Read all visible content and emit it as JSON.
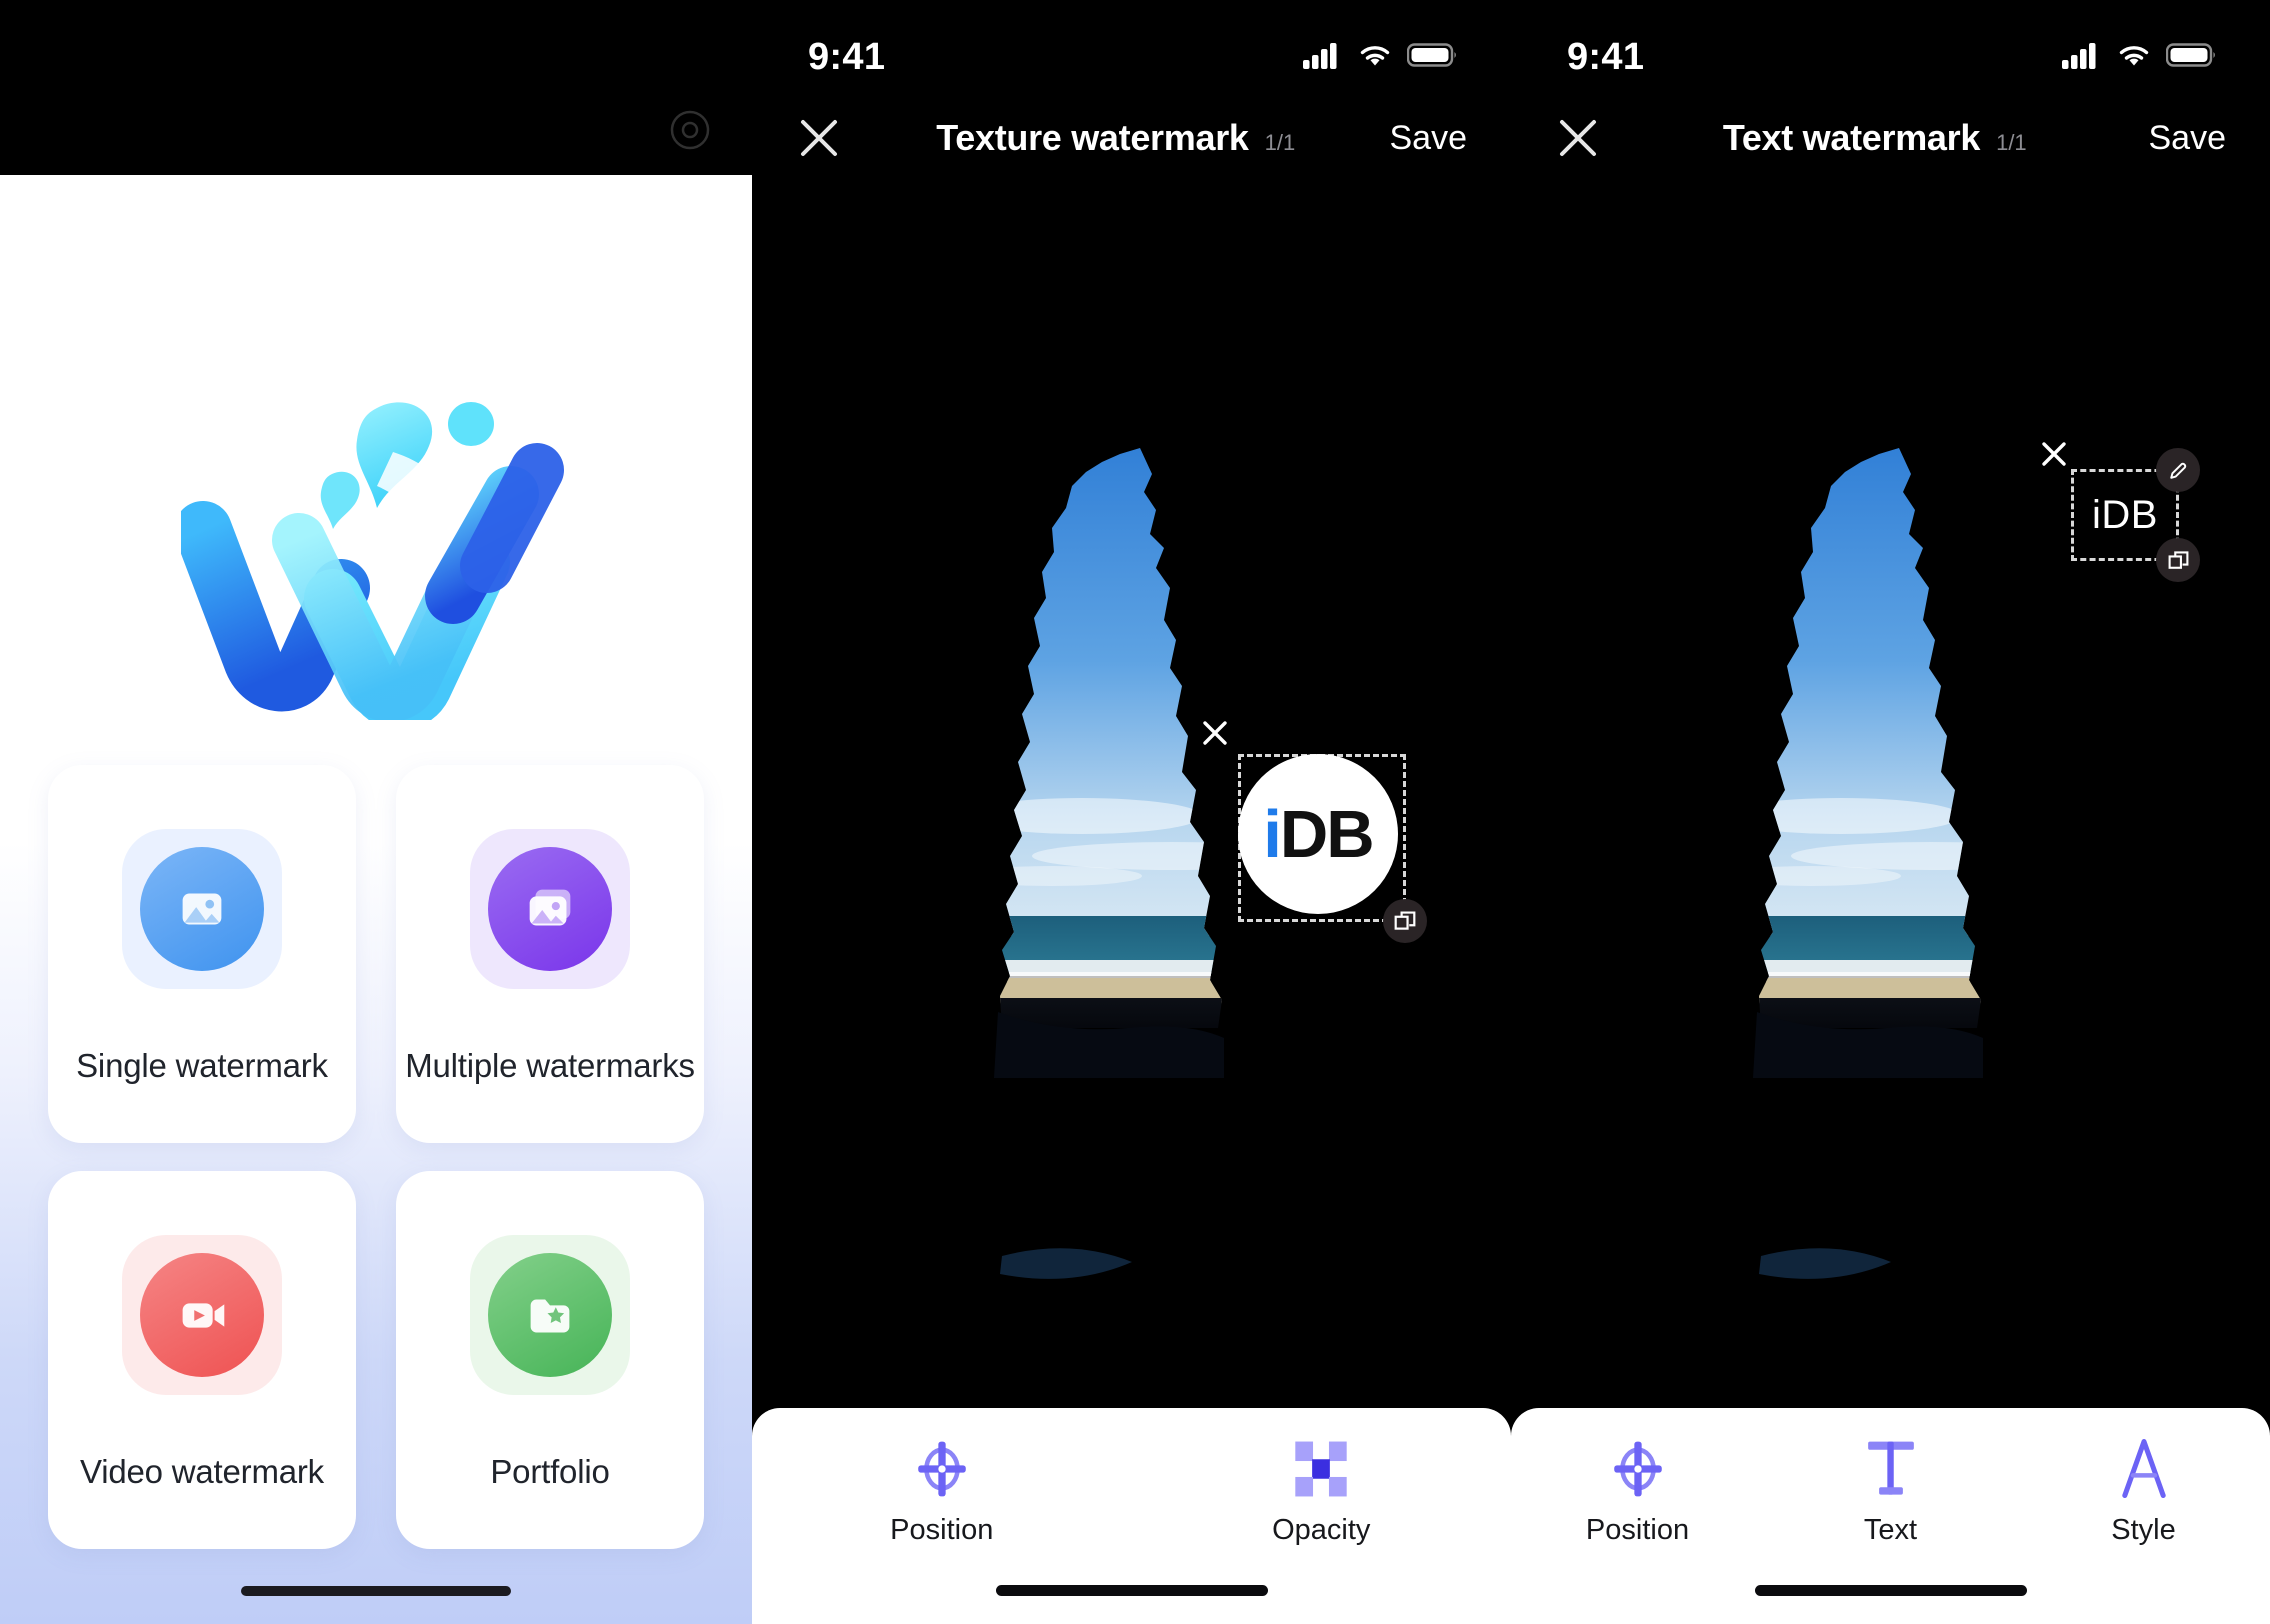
{
  "app": {
    "name": "Watermark app",
    "accent": "#6c63f5",
    "brand_blue": "#1f7bea"
  },
  "panel1": {
    "gear_icon": "gear-icon",
    "logo_alt": "watermark-logo",
    "cards": [
      {
        "label": "Single watermark",
        "icon": "image-icon",
        "tint_bg": "#eaf1ff",
        "tint_circle_from": "#7cb6f7",
        "tint_circle_to": "#3f93ef"
      },
      {
        "label": "Multiple watermarks",
        "icon": "images-stack-icon",
        "tint_bg": "#eee7fd",
        "tint_circle_from": "#9a6cf2",
        "tint_circle_to": "#7a35ea"
      },
      {
        "label": "Video watermark",
        "icon": "video-camera-icon",
        "tint_bg": "#fdeaea",
        "tint_circle_from": "#f58585",
        "tint_circle_to": "#ef5252"
      },
      {
        "label": "Portfolio",
        "icon": "folder-star-icon",
        "tint_bg": "#eaf7ea",
        "tint_circle_from": "#83d08a",
        "tint_circle_to": "#46b457"
      }
    ]
  },
  "panel2": {
    "status": {
      "time": "9:41",
      "cellular_icon": "signal-bars-icon",
      "wifi_icon": "wifi-icon",
      "battery_icon": "battery-icon"
    },
    "nav": {
      "close_icon": "close-icon",
      "title": "Texture watermark",
      "count": "1/1",
      "save_label": "Save"
    },
    "photo_alt": "cave-opening-beach-photo",
    "watermark": {
      "type": "texture",
      "text_i": "i",
      "text_db": "DB",
      "delete_icon": "close-icon",
      "resize_icon": "resize-handle-icon"
    },
    "toolbar": [
      {
        "label": "Position",
        "icon": "position-target-icon"
      },
      {
        "label": "Opacity",
        "icon": "opacity-checker-icon"
      }
    ]
  },
  "panel3": {
    "status": {
      "time": "9:41",
      "cellular_icon": "signal-bars-icon",
      "wifi_icon": "wifi-icon",
      "battery_icon": "battery-icon"
    },
    "nav": {
      "close_icon": "close-icon",
      "title": "Text watermark",
      "count": "1/1",
      "save_label": "Save"
    },
    "photo_alt": "cave-opening-beach-photo",
    "watermark": {
      "type": "text",
      "text": "iDB",
      "delete_icon": "close-icon",
      "edit_icon": "pencil-icon",
      "resize_icon": "resize-handle-icon"
    },
    "toolbar": [
      {
        "label": "Position",
        "icon": "position-target-icon"
      },
      {
        "label": "Text",
        "icon": "text-t-icon"
      },
      {
        "label": "Style",
        "icon": "style-a-icon"
      }
    ]
  }
}
